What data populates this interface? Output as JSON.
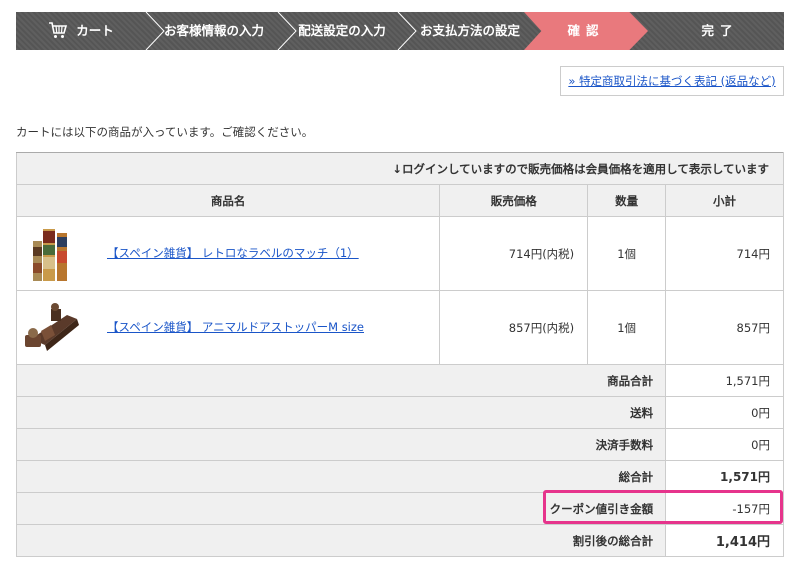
{
  "steps": [
    {
      "label": "カート",
      "state": "done"
    },
    {
      "label": "お客様情報の入力",
      "state": "done"
    },
    {
      "label": "配送設定の入力",
      "state": "done"
    },
    {
      "label": "お支払方法の設定",
      "state": "done"
    },
    {
      "label": "確認",
      "state": "active"
    },
    {
      "label": "完了",
      "state": "pending"
    }
  ],
  "law_link": "» 特定商取引法に基づく表記 (返品など)",
  "intro_text": "カートには以下の商品が入っています。ご確認ください。",
  "table": {
    "notice": "↓ログインしていますので販売価格は会員価格を適用して表示しています",
    "headers": {
      "name": "商品名",
      "price": "販売価格",
      "qty": "数量",
      "subtotal": "小計"
    },
    "items": [
      {
        "name": "【スペイン雑貨】 レトロなラベルのマッチ（1）",
        "price": "714円(内税)",
        "qty": "1個",
        "subtotal": "714円"
      },
      {
        "name": "【スペイン雑貨】 アニマルドアストッパーM size",
        "price": "857円(内税)",
        "qty": "1個",
        "subtotal": "857円"
      }
    ],
    "summary": [
      {
        "label": "商品合計",
        "value": "1,571円"
      },
      {
        "label": "送料",
        "value": "0円"
      },
      {
        "label": "決済手数料",
        "value": "0円"
      },
      {
        "label": "総合計",
        "value": "1,571円"
      },
      {
        "label": "クーポン値引き金額",
        "value": "-157円"
      },
      {
        "label": "割引後の総合計",
        "value": "1,414円"
      }
    ]
  },
  "colors": {
    "step_bg": "#555555",
    "step_active": "#e9797d",
    "link": "#1a55c8",
    "highlight": "#e6348c"
  }
}
